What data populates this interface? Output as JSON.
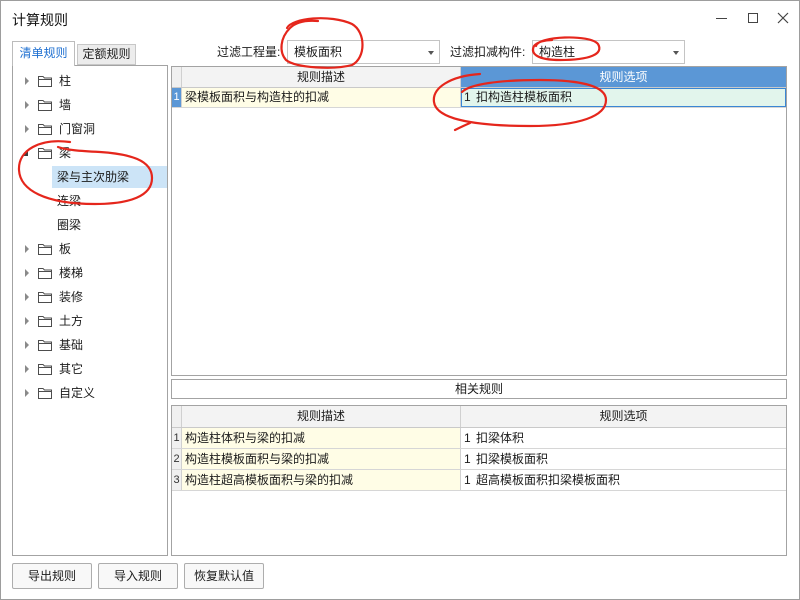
{
  "window": {
    "title": "计算规则",
    "controls": [
      "minimize-icon",
      "maximize-icon",
      "close-icon"
    ]
  },
  "tabs": [
    {
      "label": "清单规则",
      "active": true
    },
    {
      "label": "定额规则",
      "active": false
    }
  ],
  "filters": {
    "quantity": {
      "label": "过滤工程量:",
      "value": "模板面积",
      "icon": "chevron-down-icon"
    },
    "deduct_component": {
      "label": "过滤扣减构件:",
      "value": "构造柱",
      "icon": "chevron-down-icon"
    }
  },
  "tree": {
    "icons": {
      "collapsed": "caret-right-icon",
      "expanded": "caret-down-icon",
      "node": "folder-icon"
    },
    "items": [
      {
        "label": "柱",
        "expanded": false
      },
      {
        "label": "墙",
        "expanded": false
      },
      {
        "label": "门窗洞",
        "expanded": false
      },
      {
        "label": "梁",
        "expanded": true,
        "children": [
          {
            "label": "梁与主次肋梁",
            "selected": true
          },
          {
            "label": "连梁",
            "selected": false
          },
          {
            "label": "圈梁",
            "selected": false
          }
        ]
      },
      {
        "label": "板",
        "expanded": false
      },
      {
        "label": "楼梯",
        "expanded": false
      },
      {
        "label": "装修",
        "expanded": false
      },
      {
        "label": "土方",
        "expanded": false
      },
      {
        "label": "基础",
        "expanded": false
      },
      {
        "label": "其它",
        "expanded": false
      },
      {
        "label": "自定义",
        "expanded": false
      }
    ]
  },
  "rules_grid": {
    "headers": {
      "description": "规则描述",
      "option": "规则选项"
    },
    "rows": [
      {
        "num": "1",
        "description": "梁模板面积与构造柱的扣减",
        "option_index": "1",
        "option": "扣构造柱模板面积",
        "selected": true
      }
    ]
  },
  "related_rules": {
    "title": "相关规则",
    "headers": {
      "description": "规则描述",
      "option": "规则选项"
    },
    "rows": [
      {
        "num": "1",
        "description": "构造柱体积与梁的扣减",
        "option_index": "1",
        "option": "扣梁体积"
      },
      {
        "num": "2",
        "description": "构造柱模板面积与梁的扣减",
        "option_index": "1",
        "option": "扣梁模板面积"
      },
      {
        "num": "3",
        "description": "构造柱超高模板面积与梁的扣减",
        "option_index": "1",
        "option": "超高模板面积扣梁模板面积"
      }
    ]
  },
  "buttons": {
    "export": "导出规则",
    "import": "导入规则",
    "reset": "恢复默认值"
  },
  "colors": {
    "accent": "#1e6fd0",
    "selection": "#cce4f7",
    "header_selected": "#5b97d6",
    "description_cell": "#fffde6",
    "option_cell_selected": "#e2f5ec",
    "selected_border": "#3a86d4",
    "annotation": "#e5261c"
  }
}
